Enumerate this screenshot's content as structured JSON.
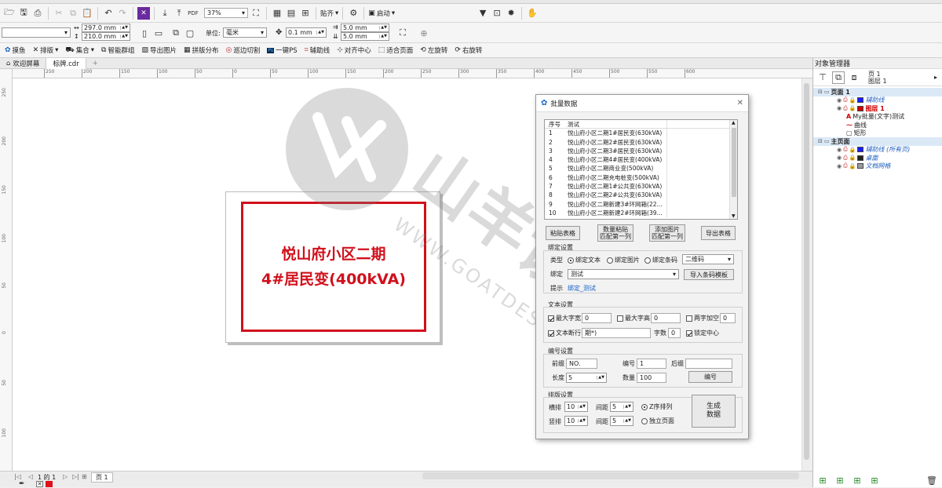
{
  "toolbar1": {
    "zoom": "37%",
    "snap_label": "贴齐",
    "launch_label": "启动"
  },
  "toolbar2": {
    "width": "297.0 mm",
    "height": "210.0 mm",
    "unit_label": "单位:",
    "unit_value": "毫米",
    "nudge": "0.1 mm",
    "dup_x": "5.0 mm",
    "dup_y": "5.0 mm"
  },
  "toolbar3": {
    "items": [
      "摸鱼",
      "排版",
      "集合",
      "智能群组",
      "导出图片",
      "拼版分布",
      "巡边切割",
      "一键PS",
      "辅助线",
      "对齐中心",
      "适合页面",
      "左旋转",
      "右旋转"
    ]
  },
  "tabs": [
    "欢迎屏幕",
    "标牌.cdr"
  ],
  "ruler_h_ticks": [
    "250",
    "200",
    "150",
    "100",
    "50",
    "0",
    "50",
    "100",
    "150",
    "200",
    "250",
    "300",
    "350",
    "400",
    "450",
    "500",
    "550",
    "600"
  ],
  "ruler_v_ticks": [
    "250",
    "200",
    "150",
    "100",
    "50",
    "0",
    "50",
    "100"
  ],
  "sign": {
    "line1": "悦山府小区二期",
    "line2": "4#居民变(400kVA)"
  },
  "watermark": {
    "big": "山羊设计库",
    "url": "WWW.GOATDESIGN.CN"
  },
  "status": {
    "page_info": "1 的 1",
    "page_tab": "页 1"
  },
  "dialog": {
    "title": "批量数据",
    "headers": [
      "序号",
      "测试"
    ],
    "rows": [
      [
        "1",
        "悦山府小区二期1#居民变(630kVA)"
      ],
      [
        "2",
        "悦山府小区二期2#居民变(630kVA)"
      ],
      [
        "3",
        "悦山府小区二期3#居民变(630kVA)"
      ],
      [
        "4",
        "悦山府小区二期4#居民变(400kVA)"
      ],
      [
        "5",
        "悦山府小区二期商业变(500kVA)"
      ],
      [
        "6",
        "悦山府小区二期充电桩变(500kVA)"
      ],
      [
        "7",
        "悦山府小区二期1#公共变(630kVA)"
      ],
      [
        "8",
        "悦山府小区二期2#公共变(630kVA)"
      ],
      [
        "9",
        "悦山府小区二期新建3#环网箱(22..."
      ],
      [
        "10",
        "悦山府小区二期新建2#环网箱(39..."
      ]
    ],
    "btn_paste": "粘贴表格",
    "btn_paste_match": "数量粘贴\n匹配第一列",
    "btn_add_image": "添加图片\n匹配第一列",
    "btn_export": "导出表格",
    "bind_group": "绑定设置",
    "type_label": "类型",
    "type_text": "绑定文本",
    "type_image": "绑定图片",
    "type_barcode": "绑定条码",
    "barcode_kind": "二维码",
    "bind_label": "绑定",
    "bind_value": "测试",
    "btn_import_barcode": "导入条码模板",
    "hint_label": "提示",
    "hint_value": "绑定_测试",
    "text_group": "文本设置",
    "max_width_label": "最大字宽",
    "max_width_value": "0",
    "max_height_label": "最大字高",
    "max_height_value": "0",
    "two_char_label": "两字加空",
    "two_char_value": "0",
    "line_break_label": "文本断行",
    "line_break_value": "期*)",
    "char_count_label": "字数",
    "char_count_value": "0",
    "lock_center_label": "锁定中心",
    "num_group": "编号设置",
    "prefix_label": "前缀",
    "prefix_value": "NO.",
    "number_label": "编号",
    "number_value": "1",
    "suffix_label": "后缀",
    "suffix_value": "",
    "length_label": "长度",
    "length_value": "5",
    "count_label": "数量",
    "count_value": "100",
    "btn_number": "编号",
    "layout_group": "排版设置",
    "h_label": "横排",
    "h_value": "10",
    "h_gap_label": "间距",
    "h_gap_value": "5",
    "z_order_label": "Z序排列",
    "v_label": "竖排",
    "v_value": "10",
    "v_gap_label": "间距",
    "v_gap_value": "5",
    "independent_label": "独立页面",
    "btn_generate": "生成\n数据"
  },
  "object_manager": {
    "title": "对象管理器",
    "page_name": "页 1",
    "layer_name": "图层 1",
    "tree": [
      {
        "label": "页面 1",
        "kind": "page"
      },
      {
        "label": "辅助线",
        "kind": "layer",
        "color": "#1a1aff",
        "style": "guide"
      },
      {
        "label": "图层 1",
        "kind": "layer",
        "color": "#cc0000",
        "style": "active"
      },
      {
        "label": "My批量(文字)测试",
        "kind": "obj-text"
      },
      {
        "label": "曲线",
        "kind": "obj-curve"
      },
      {
        "label": "矩形",
        "kind": "obj-rect"
      },
      {
        "label": "主页面",
        "kind": "page"
      },
      {
        "label": "辅助线 (所有页)",
        "kind": "layer",
        "color": "#1a1aff",
        "style": "guide"
      },
      {
        "label": "桌面",
        "kind": "layer",
        "color": "#222222",
        "style": "guide"
      },
      {
        "label": "文档网格",
        "kind": "layer",
        "color": "#9a9aa0",
        "style": "guide"
      }
    ]
  }
}
